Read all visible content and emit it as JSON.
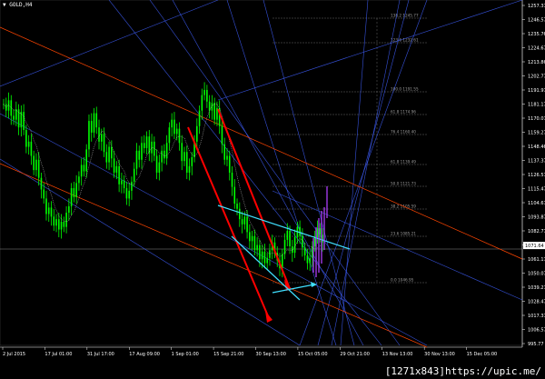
{
  "chart": {
    "symbol_label": "▼ GOLD,H4",
    "watermark": "[1271x843]https://upic.me/"
  },
  "colors": {
    "background": "#000000",
    "candle": "#00ff00",
    "axis": "#ffffff",
    "fibo": "#6a6a6a",
    "channel": "#ff4500",
    "trend_fan": "#4060ff",
    "arrow_red": "#ff0000",
    "arrow_cyan": "#40e0ff",
    "signal": "#b040ff",
    "price_highlight_bg": "#ffffff"
  },
  "price_axis": {
    "labels": [
      "1257.37",
      "1246.57",
      "1235.76",
      "1224.67",
      "1213.86",
      "1202.77",
      "1191.97",
      "1181.17",
      "1170.07",
      "1159.27",
      "1148.46",
      "1137.37",
      "1126.57",
      "1115.47",
      "1104.67",
      "1093.87",
      "1082.77",
      "1071.97",
      "1061.17",
      "1050.07",
      "1039.27",
      "1028.47",
      "1017.37",
      "1006.57",
      "995.77"
    ],
    "current_price": "1071.64"
  },
  "time_axis": {
    "labels": [
      "2 Jul 2015",
      "17 Jul 01:00",
      "31 Jul 17:00",
      "17 Aug 09:00",
      "1 Sep 01:00",
      "15 Sep 21:00",
      "30 Sep 13:00",
      "15 Oct 05:00",
      "29 Oct 21:00",
      "13 Nov 13:00",
      "30 Nov 13:00",
      "15 Dec 05:00"
    ]
  },
  "fibonacci": {
    "levels": [
      "138.2 1245.77",
      "123.6 1232.61",
      "100.0 1191.55",
      "61.8 1174.96",
      "76.4 1160.40",
      "61.8 1139.49",
      "50.0 1121.73",
      "38.2 1105.59",
      "23.6 1085.21",
      "0.0 1046.95"
    ]
  },
  "chart_data": {
    "type": "candlestick",
    "symbol": "GOLD",
    "timeframe": "H4",
    "current_price": 1071.64,
    "ylim": [
      995.77,
      1257.37
    ],
    "close_series": [
      1181,
      1176,
      1184,
      1172,
      1169,
      1177,
      1163,
      1175,
      1161,
      1148,
      1152,
      1141,
      1130,
      1138,
      1124,
      1115,
      1108,
      1096,
      1101,
      1094,
      1087,
      1092,
      1084,
      1090,
      1086,
      1097,
      1102,
      1116,
      1109,
      1120,
      1125,
      1134,
      1129,
      1146,
      1168,
      1159,
      1174,
      1163,
      1152,
      1158,
      1144,
      1136,
      1148,
      1139,
      1128,
      1133,
      1119,
      1122,
      1116,
      1108,
      1114,
      1121,
      1131,
      1145,
      1138,
      1151,
      1147,
      1156,
      1143,
      1152,
      1141,
      1128,
      1136,
      1145,
      1139,
      1151,
      1163,
      1169,
      1158,
      1162,
      1151,
      1137,
      1144,
      1128,
      1133,
      1140,
      1152,
      1164,
      1176,
      1188,
      1192,
      1183,
      1176,
      1182,
      1169,
      1178,
      1164,
      1150,
      1138,
      1141,
      1128,
      1117,
      1104,
      1100,
      1092,
      1088,
      1094,
      1082,
      1075,
      1079,
      1068,
      1072,
      1061,
      1067,
      1058,
      1062,
      1068,
      1074,
      1066,
      1060,
      1054,
      1065,
      1076,
      1083,
      1071,
      1066,
      1078,
      1086,
      1079,
      1070,
      1064,
      1058,
      1062,
      1071,
      1078,
      1085,
      1080,
      1074
    ]
  }
}
